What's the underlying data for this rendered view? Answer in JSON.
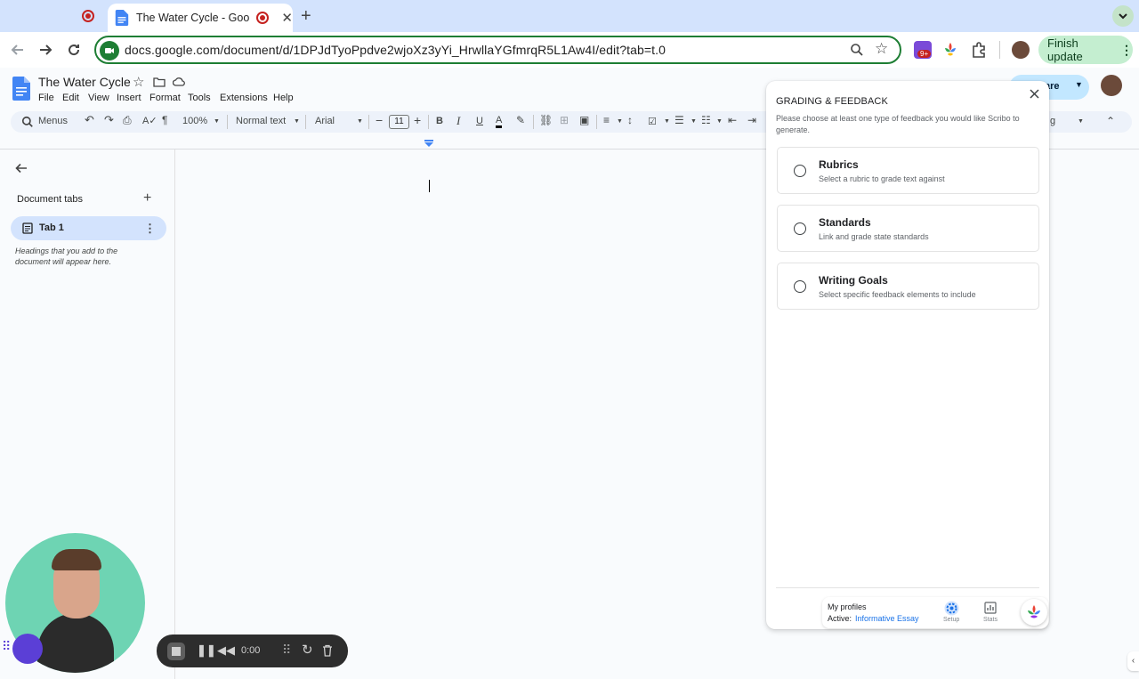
{
  "browser": {
    "active_tab_title": "The Water Cycle - Google",
    "url": "docs.google.com/document/d/1DPJdTyoPpdve2wjoXz3yYi_HrwllaYGfmrqR5L1Aw4I/edit?tab=t.0",
    "new_tab_icon": "plus-icon",
    "extension_badge": "9+",
    "finish_update_label": "Finish update"
  },
  "docs": {
    "title": "The Water Cycle",
    "menu": [
      "File",
      "Edit",
      "View",
      "Insert",
      "Format",
      "Tools",
      "Extensions",
      "Help"
    ],
    "share_label_partial": "are",
    "editing_partial": "g",
    "toolbar": {
      "menus_label": "Menus",
      "zoom": "100%",
      "style": "Normal text",
      "font": "Arial",
      "font_size": "11"
    }
  },
  "sidebar": {
    "section_label": "Document tabs",
    "tab_label": "Tab 1",
    "hint": "Headings that you add to the document will appear here."
  },
  "panel": {
    "title": "GRADING & FEEDBACK",
    "description": "Please choose at least one type of feedback you would like Scribo to generate.",
    "options": [
      {
        "title": "Rubrics",
        "desc": "Select a rubric to grade text against"
      },
      {
        "title": "Standards",
        "desc": "Link and grade state standards"
      },
      {
        "title": "Writing Goals",
        "desc": "Select specific feedback elements to include"
      }
    ],
    "profiles_label": "My profiles",
    "active_prefix": "Active:",
    "active_profile": "Informative Essay",
    "setup_label": "Setup",
    "stats_label": "Stats",
    "accent": "#1a73e8"
  },
  "recorder": {
    "time": "0:00"
  }
}
